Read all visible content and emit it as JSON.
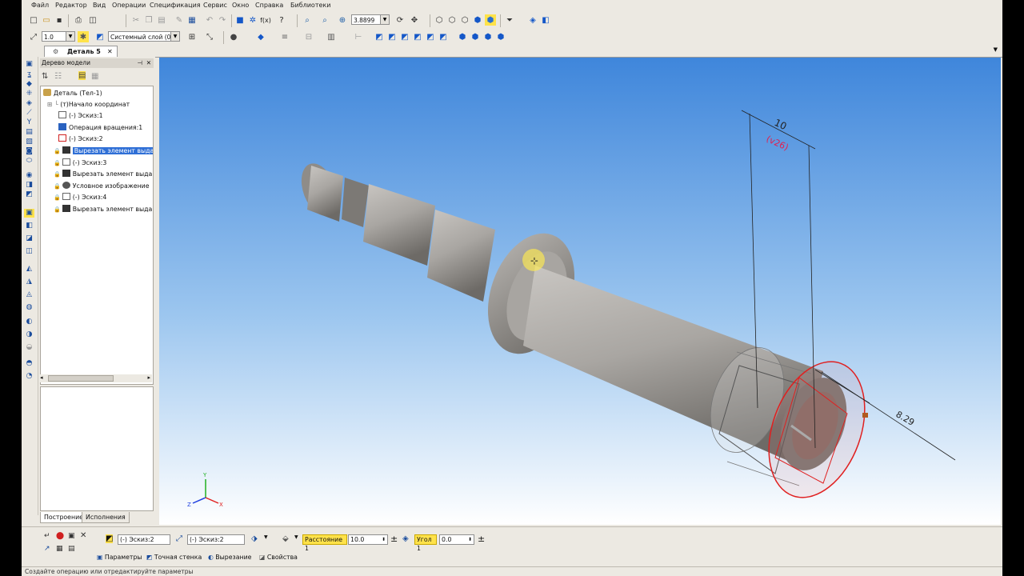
{
  "menu": [
    "Файл",
    "Редактор",
    "Вид",
    "Операции",
    "Спецификация",
    "Сервис",
    "Окно",
    "Справка",
    "Библиотеки"
  ],
  "toolbar": {
    "zoom_value": "3.8899",
    "line_scale": "1.0",
    "layer": "Системный слой (0)"
  },
  "document_tab": "Деталь 5",
  "tree_panel": {
    "title": "Дерево модели",
    "nodes": [
      "Деталь (Тел-1)",
      "(т)Начало координат",
      "(-) Эскиз:1",
      "Операция вращения:1",
      "(-) Эскиз:2",
      "Вырезать элемент выда",
      "(-) Эскиз:3",
      "Вырезать элемент выда",
      "Условное изображение",
      "(-) Эскиз:4",
      "Вырезать элемент выда"
    ],
    "tabs": [
      "Построение",
      "Исполнения"
    ]
  },
  "viewport": {
    "dim_top": "10",
    "dim_top_sub": "(v26)",
    "dim_side": "8.29",
    "axis_x": "X",
    "axis_y": "Y",
    "axis_z": "Z"
  },
  "properties": {
    "sketch1": "(-) Эскиз:2",
    "sketch2": "(-) Эскиз:2",
    "distance_label": "Расстояние 1",
    "distance_value": "10.0",
    "angle_label": "Угол 1",
    "angle_value": "0.0",
    "tabs": [
      "Параметры",
      "Точная стенка",
      "Вырезание",
      "Свойства"
    ]
  },
  "status_text": "Создайте операцию или отредактируйте параметры",
  "colors": {
    "viewport_top": "#3f86db",
    "viewport_bottom": "#ffffff",
    "selection": "#2f6fd6",
    "highlight": "#ffe24a",
    "sketch_red": "#e02020"
  }
}
